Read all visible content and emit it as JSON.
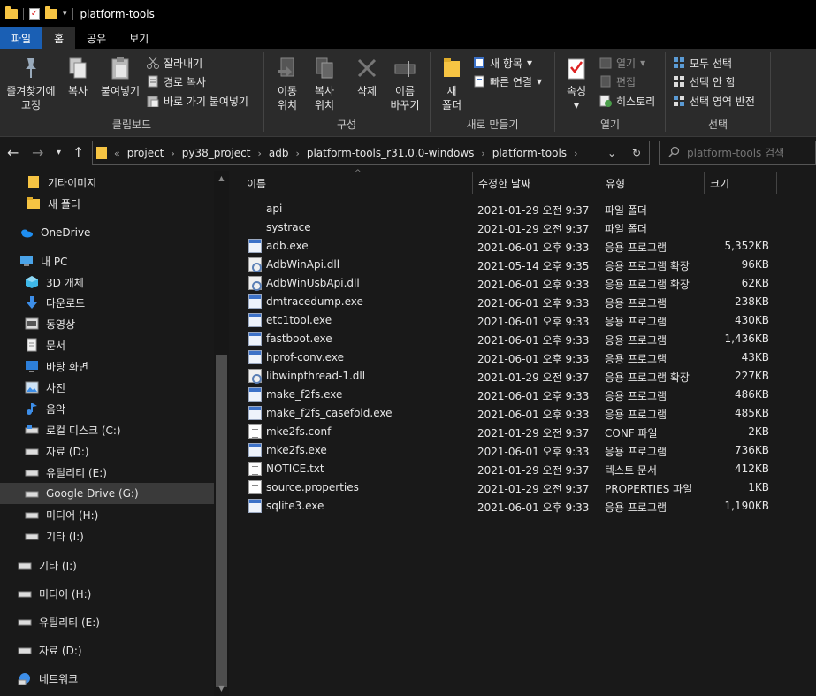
{
  "window": {
    "title": "platform-tools"
  },
  "tabs": [
    {
      "label": "파일"
    },
    {
      "label": "홈"
    },
    {
      "label": "공유"
    },
    {
      "label": "보기"
    }
  ],
  "ribbon": {
    "clipboard": {
      "label": "클립보드",
      "pin": "즐겨찾기에\n고정",
      "pin_l1": "즐겨찾기에",
      "pin_l2": "고정",
      "copy": "복사",
      "paste": "붙여넣기",
      "cut": "잘라내기",
      "copy_path": "경로 복사",
      "paste_shortcut": "바로 가기 붙여넣기"
    },
    "organize": {
      "label": "구성",
      "move_l1": "이동",
      "move_l2": "위치",
      "copyto_l1": "복사",
      "copyto_l2": "위치",
      "delete": "삭제",
      "rename_l1": "이름",
      "rename_l2": "바꾸기"
    },
    "new": {
      "label": "새로 만들기",
      "folder_l1": "새",
      "folder_l2": "폴더",
      "new_item": "새 항목",
      "easy_access": "빠른 연결"
    },
    "open": {
      "label": "열기",
      "properties": "속성",
      "open": "열기",
      "edit": "편집",
      "history": "히스토리"
    },
    "select": {
      "label": "선택",
      "select_all": "모두 선택",
      "select_none": "선택 안 함",
      "invert": "선택 영역 반전"
    }
  },
  "address": {
    "overflow": "«",
    "crumbs": [
      "project",
      "py38_project",
      "adb",
      "platform-tools_r31.0.0-windows",
      "platform-tools"
    ]
  },
  "search": {
    "placeholder": "platform-tools 검색"
  },
  "sidebar": {
    "items": [
      {
        "label": "기타이미지",
        "icon": "folder-icon"
      },
      {
        "label": "새 폴더",
        "icon": "folder-icon"
      },
      {
        "label": "OneDrive",
        "icon": "cloud-icon"
      },
      {
        "label": "내 PC",
        "icon": "pc-icon"
      },
      {
        "label": "3D 개체",
        "icon": "cube-icon"
      },
      {
        "label": "다운로드",
        "icon": "download-icon"
      },
      {
        "label": "동영상",
        "icon": "video-icon"
      },
      {
        "label": "문서",
        "icon": "document-icon"
      },
      {
        "label": "바탕 화면",
        "icon": "desktop-icon"
      },
      {
        "label": "사진",
        "icon": "picture-icon"
      },
      {
        "label": "음악",
        "icon": "music-icon"
      },
      {
        "label": "로컬 디스크 (C:)",
        "icon": "drive-icon"
      },
      {
        "label": "자료 (D:)",
        "icon": "drive-icon"
      },
      {
        "label": "유틸리티 (E:)",
        "icon": "drive-icon"
      },
      {
        "label": "Google Drive (G:)",
        "icon": "drive-icon"
      },
      {
        "label": "미디어 (H:)",
        "icon": "drive-icon"
      },
      {
        "label": "기타 (I:)",
        "icon": "drive-icon"
      },
      {
        "label": "기타 (I:)",
        "icon": "drive-icon"
      },
      {
        "label": "미디어 (H:)",
        "icon": "drive-icon"
      },
      {
        "label": "유틸리티 (E:)",
        "icon": "drive-icon"
      },
      {
        "label": "자료 (D:)",
        "icon": "drive-icon"
      },
      {
        "label": "네트워크",
        "icon": "network-icon"
      }
    ]
  },
  "columns": {
    "name": "이름",
    "modified": "수정한 날짜",
    "type": "유형",
    "size": "크기"
  },
  "files": [
    {
      "name": "api",
      "modified": "2021-01-29 오전 9:37",
      "type": "파일 폴더",
      "size": "",
      "icon": "folder"
    },
    {
      "name": "systrace",
      "modified": "2021-01-29 오전 9:37",
      "type": "파일 폴더",
      "size": "",
      "icon": "folder"
    },
    {
      "name": "adb.exe",
      "modified": "2021-06-01 오후 9:33",
      "type": "응용 프로그램",
      "size": "5,352KB",
      "icon": "exe"
    },
    {
      "name": "AdbWinApi.dll",
      "modified": "2021-05-14 오후 9:35",
      "type": "응용 프로그램 확장",
      "size": "96KB",
      "icon": "dll"
    },
    {
      "name": "AdbWinUsbApi.dll",
      "modified": "2021-06-01 오후 9:33",
      "type": "응용 프로그램 확장",
      "size": "62KB",
      "icon": "dll"
    },
    {
      "name": "dmtracedump.exe",
      "modified": "2021-06-01 오후 9:33",
      "type": "응용 프로그램",
      "size": "238KB",
      "icon": "exe"
    },
    {
      "name": "etc1tool.exe",
      "modified": "2021-06-01 오후 9:33",
      "type": "응용 프로그램",
      "size": "430KB",
      "icon": "exe"
    },
    {
      "name": "fastboot.exe",
      "modified": "2021-06-01 오후 9:33",
      "type": "응용 프로그램",
      "size": "1,436KB",
      "icon": "exe"
    },
    {
      "name": "hprof-conv.exe",
      "modified": "2021-06-01 오후 9:33",
      "type": "응용 프로그램",
      "size": "43KB",
      "icon": "exe"
    },
    {
      "name": "libwinpthread-1.dll",
      "modified": "2021-01-29 오전 9:37",
      "type": "응용 프로그램 확장",
      "size": "227KB",
      "icon": "dll"
    },
    {
      "name": "make_f2fs.exe",
      "modified": "2021-06-01 오후 9:33",
      "type": "응용 프로그램",
      "size": "486KB",
      "icon": "exe"
    },
    {
      "name": "make_f2fs_casefold.exe",
      "modified": "2021-06-01 오후 9:33",
      "type": "응용 프로그램",
      "size": "485KB",
      "icon": "exe"
    },
    {
      "name": "mke2fs.conf",
      "modified": "2021-01-29 오전 9:37",
      "type": "CONF 파일",
      "size": "2KB",
      "icon": "txt"
    },
    {
      "name": "mke2fs.exe",
      "modified": "2021-06-01 오후 9:33",
      "type": "응용 프로그램",
      "size": "736KB",
      "icon": "exe"
    },
    {
      "name": "NOTICE.txt",
      "modified": "2021-01-29 오전 9:37",
      "type": "텍스트 문서",
      "size": "412KB",
      "icon": "txt"
    },
    {
      "name": "source.properties",
      "modified": "2021-01-29 오전 9:37",
      "type": "PROPERTIES 파일",
      "size": "1KB",
      "icon": "txt"
    },
    {
      "name": "sqlite3.exe",
      "modified": "2021-06-01 오후 9:33",
      "type": "응용 프로그램",
      "size": "1,190KB",
      "icon": "exe"
    }
  ]
}
